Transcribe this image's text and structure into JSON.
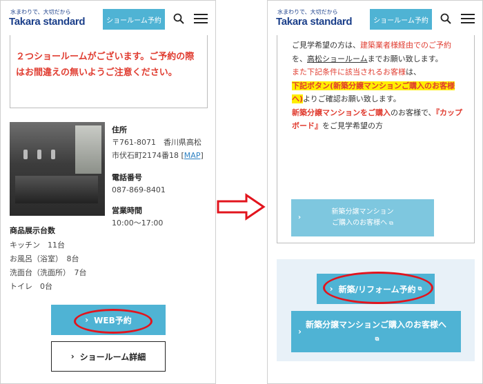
{
  "header": {
    "tagline": "水まわりで、大切だから",
    "logo": "Takara standard",
    "reserve_button": "ショールーム予約"
  },
  "left": {
    "notice": "２つショールームがございます。ご予約の際はお間違えの無いようご注意ください。",
    "address_label": "住所",
    "address_line1": "〒761-8071　香川県高松",
    "address_line2": "市伏石町2174番18",
    "map_link": "MAP",
    "phone_label": "電話番号",
    "phone": "087-869-8401",
    "hours_label": "営業時間",
    "hours": "10:00〜17:00",
    "spec_title": "商品展示台数",
    "specs": [
      "キッチン　11台",
      "お風呂（浴室）　8台",
      "洗面台（洗面所）　7台",
      "トイレ　0台"
    ],
    "web_button": "WEB予約",
    "detail_button": "ショールーム詳細"
  },
  "right": {
    "t1": "ご見学希望の方は、",
    "t2": "建築業者様経由でのご予約",
    "t3": "を、",
    "t4": "高松ショールーム",
    "t5": "までお願い致します。",
    "t6": "また下記条件に該当されるお客様",
    "t7": "は、",
    "t8": "下記ボタン(新築分譲マンションご購入のお客様へ)",
    "t9": "よりご確認お願い致します。",
    "t10": "新築分譲マンションをご購入",
    "t11": "のお客様で、",
    "t12": "『カップボード』",
    "t13": "をご見学希望の方",
    "btn1_line1": "新築分譲マンション",
    "btn1_line2": "ご購入のお客様へ",
    "btn2": "新築/リフォーム予約",
    "btn3": "新築分譲マンションご購入のお客様へ"
  },
  "colors": {
    "accent": "#4fb3d4",
    "notice_red": "#e03c30",
    "highlight": "#ffee00",
    "annotation": "#e2141d",
    "brand": "#1b3f8a"
  }
}
